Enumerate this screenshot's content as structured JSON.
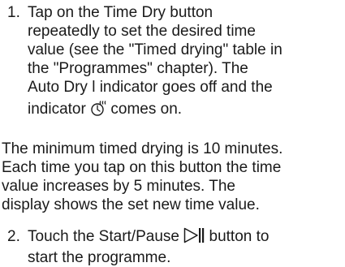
{
  "step1": {
    "number": "1.",
    "lines": [
      "Tap on the Time Dry button",
      "repeatedly to set the desired time",
      "value (see the \"Timed drying\" table in",
      "the \"Programmes\" chapter). The",
      "Auto Dry l indicator goes off and the"
    ],
    "line6_before_icon": "indicator ",
    "line6_after_icon": " comes on.",
    "icon": "timed-dry-indicator-icon"
  },
  "note": {
    "lines": [
      "The minimum timed drying is 10 minutes.",
      "Each time you tap on this button the time",
      "value increases by 5 minutes. The",
      "display shows the set new time value."
    ]
  },
  "step2": {
    "number": "2.",
    "line1_before_icon": "Touch the Start/Pause ",
    "line1_after_icon": " button to",
    "line2": "start the programme.",
    "icon": "start-pause-icon"
  }
}
